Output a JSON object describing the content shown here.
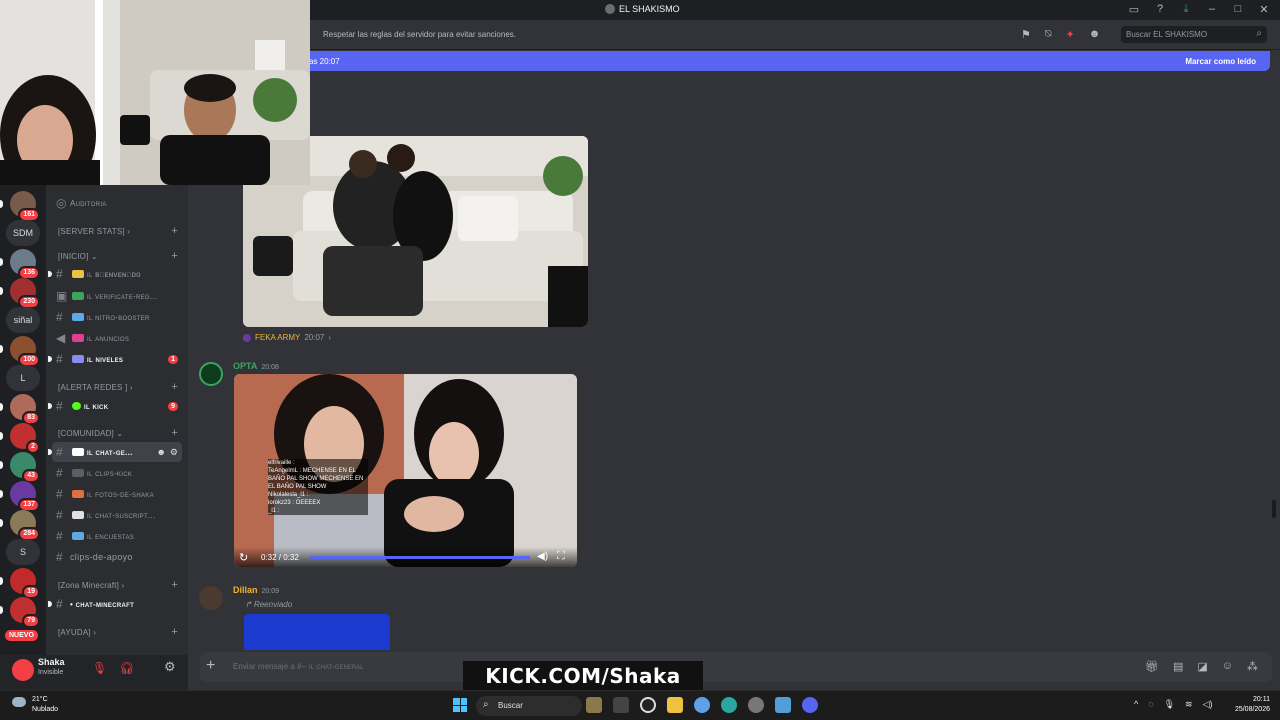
{
  "window": {
    "title": "EL SHAKISMO",
    "controls": [
      "inbox",
      "help",
      "download",
      "minimize",
      "maximize",
      "close"
    ]
  },
  "server_rail": {
    "items": [
      {
        "type": "avatar",
        "badge": "161",
        "color": "#7a5a4a"
      },
      {
        "type": "text",
        "label": "SDM"
      },
      {
        "type": "avatar",
        "badge": "136",
        "color": "#6d7a8a"
      },
      {
        "type": "avatar",
        "badge": "230",
        "color": "#a03030"
      },
      {
        "type": "text",
        "label": "siñal"
      },
      {
        "type": "avatar",
        "badge": "100",
        "color": "#8a5030"
      },
      {
        "type": "text",
        "label": "L"
      },
      {
        "type": "avatar",
        "badge": "83",
        "color": "#b06a5a"
      },
      {
        "type": "avatar",
        "badge": "2",
        "color": "#c03030"
      },
      {
        "type": "avatar",
        "badge": "43",
        "color": "#3a8a6a"
      },
      {
        "type": "avatar",
        "badge": "137",
        "color": "#6a3aa0"
      },
      {
        "type": "avatar",
        "badge": "284",
        "color": "#8a7a5a"
      },
      {
        "type": "text",
        "label": "S"
      },
      {
        "type": "avatar",
        "badge": "19",
        "color": "#c02a2a"
      },
      {
        "type": "avatar",
        "badge": "79",
        "color": "#c03030"
      },
      {
        "type": "new",
        "label": "NUEVO"
      }
    ]
  },
  "channels": {
    "top_item": "Auditoria",
    "categories": [
      {
        "name": "[SERVER STATS]"
      },
      {
        "name": "[INICIO]"
      },
      {
        "name": "[ALERTA REDES ]"
      },
      {
        "name": "[COMUNIDAD]"
      },
      {
        "name": "[Zona Minecraft]"
      },
      {
        "name": "[AYUDA]"
      }
    ],
    "items": [
      {
        "label": "ıl ʙɪᴇɴᴠᴇɴɪᴅᴏ",
        "bold": true,
        "emoji_color": "#f0c040",
        "count": ""
      },
      {
        "label": "ıl verificate-reg...",
        "bold": false,
        "emoji_color": "#3ba55c",
        "count": ""
      },
      {
        "label": "ıl nitro-booster",
        "bold": false,
        "emoji_color": "#5fa8e8",
        "count": ""
      },
      {
        "label": "ıl anuncios",
        "bold": false,
        "emoji_color": "#e04090",
        "count": ""
      },
      {
        "label": "ıl niveles",
        "bold": true,
        "emoji_color": "#8a8af0",
        "count": "1"
      },
      {
        "label": "ıl kick",
        "bold": true,
        "emoji_color": "#53fc18",
        "count": "9"
      },
      {
        "label": "ıl chat-ge...",
        "bold": true,
        "emoji_color": "#ffffff",
        "count": ""
      },
      {
        "label": "ıl clips-kick",
        "bold": false,
        "emoji_color": "#5c5e66",
        "count": ""
      },
      {
        "label": "ıl fotos-de-shaka",
        "bold": false,
        "emoji_color": "#e07040",
        "count": ""
      },
      {
        "label": "ıl chat-suscript...",
        "bold": false,
        "emoji_color": "#e0e0e0",
        "count": ""
      },
      {
        "label": "ıl encuestas",
        "bold": false,
        "emoji_color": "#5fa8e8",
        "count": ""
      },
      {
        "label": "clips-de-apoyo",
        "bold": false,
        "emoji_color": "",
        "count": ""
      },
      {
        "label": "• chat-minecraft",
        "bold": true,
        "emoji_color": "",
        "count": ""
      }
    ]
  },
  "user": {
    "name": "Shaka",
    "status": "Invisible"
  },
  "topbar": {
    "topic": "Respetar las reglas del servidor para evitar sanciones.",
    "search_placeholder": "Buscar EL SHAKISMO"
  },
  "new_messages_bar": {
    "left": "as 20:07",
    "right": "Marcar como leído"
  },
  "messages": {
    "m1": {
      "forward_from": "FEKA ARMY",
      "forward_time": "20:07"
    },
    "m2": {
      "author": "OPTA",
      "time": "20:08",
      "author_color": "#3ba55c",
      "video_time": "0:32 / 0:32",
      "progress": 1.0,
      "chat_overlay": [
        "elfrivaille : ",
        "TeAngelmL : MECHENSE EN EL BAÑO PAL SHOW MECHENSE EN EL BAÑO PAL SHOW",
        "Nikolalesla_l1 : ",
        "lorokz23 : OEEEEX",
        "_l1 : "
      ]
    },
    "m3": {
      "author": "Dillan",
      "time": "20:09",
      "author_color": "#f0b232",
      "forwarded": "Reenviado"
    }
  },
  "composer": {
    "placeholder": "Enviar mensaje a #--",
    "channel_hint": "ıl chat-general"
  },
  "overlay": {
    "watermark": "KICK.COM/Shaka"
  },
  "taskbar": {
    "temp": "21°C",
    "weather": "Nublado",
    "search": "Buscar",
    "time": "20:11",
    "date": "25/08/2026"
  }
}
